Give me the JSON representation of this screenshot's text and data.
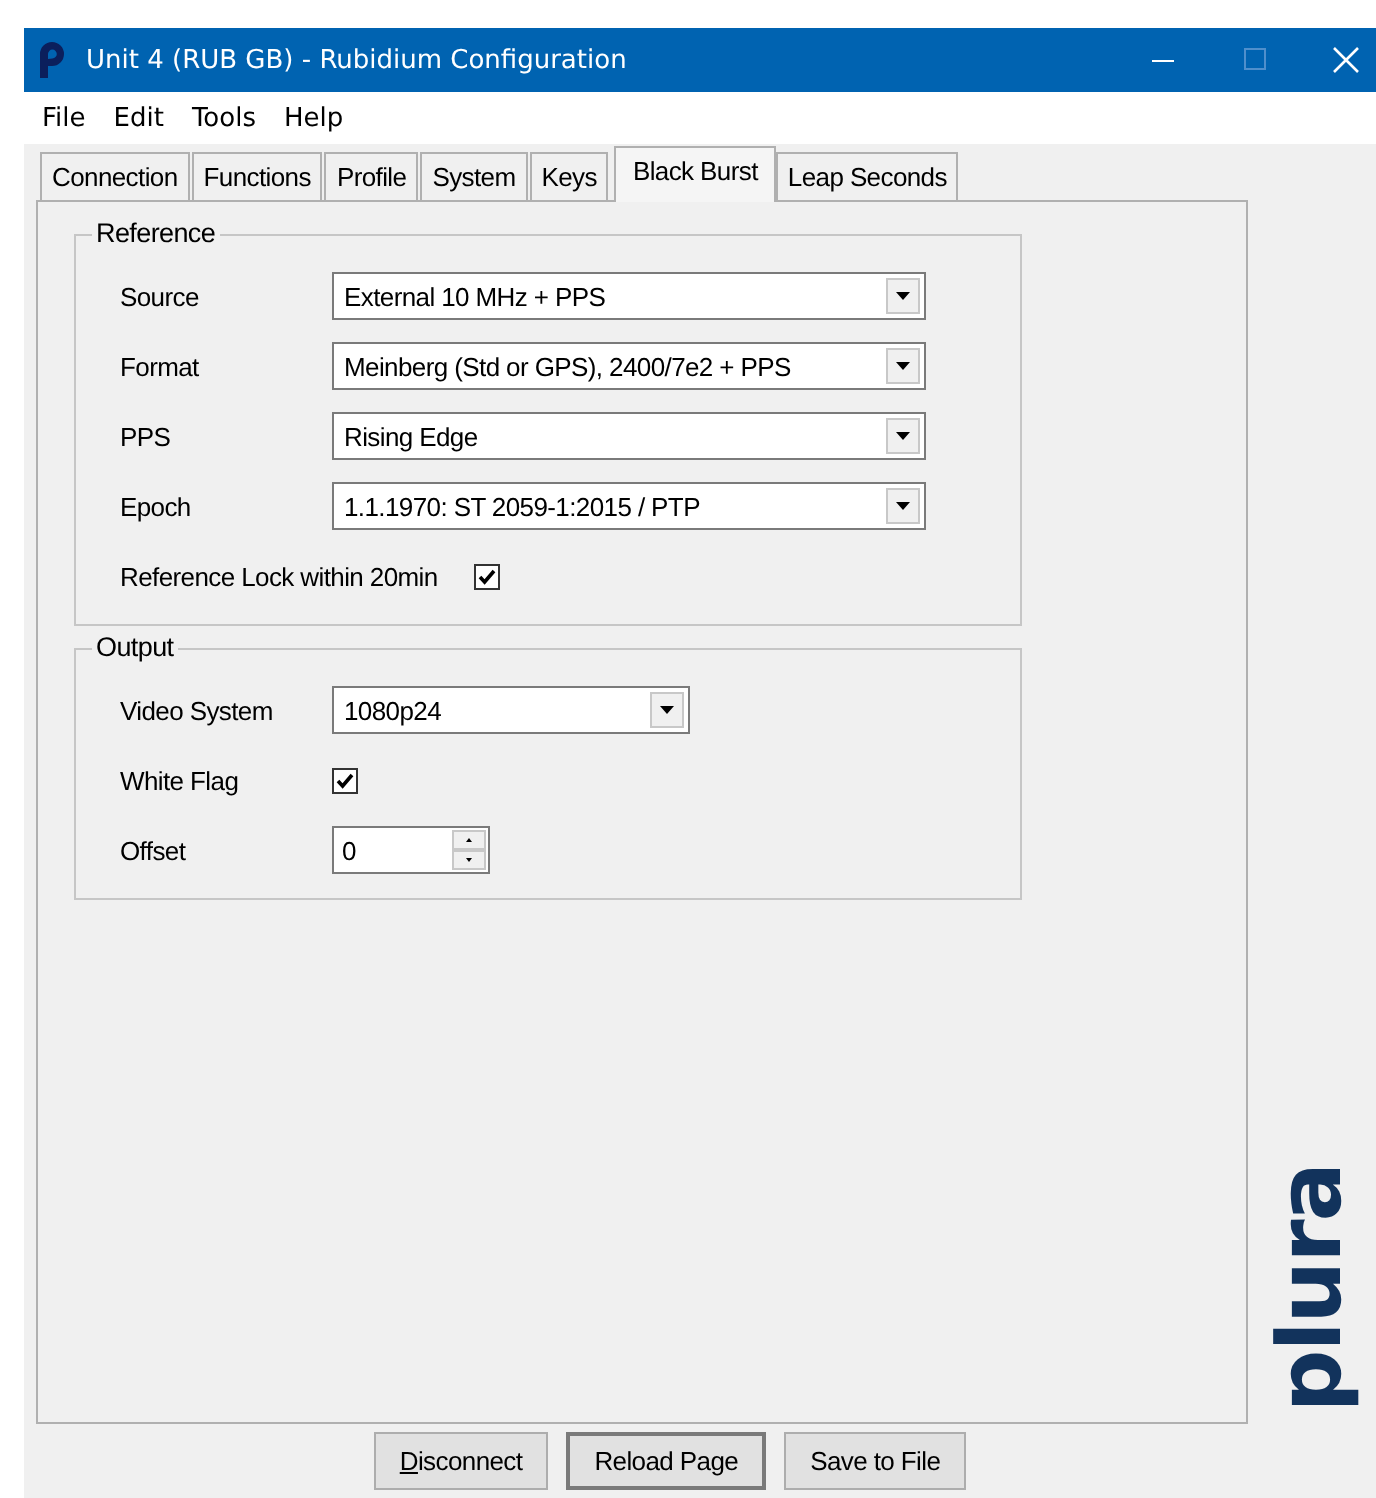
{
  "window": {
    "title": "Unit 4 (RUB GB) - Rubidium Configuration",
    "maximize_disabled": true
  },
  "menu": [
    "File",
    "Edit",
    "Tools",
    "Help"
  ],
  "tabs": [
    {
      "label": "Connection",
      "selected": false
    },
    {
      "label": "Functions",
      "selected": false
    },
    {
      "label": "Profile",
      "selected": false
    },
    {
      "label": "System",
      "selected": false
    },
    {
      "label": "Keys",
      "selected": false
    },
    {
      "label": "Black Burst",
      "selected": true
    },
    {
      "label": "Leap Seconds",
      "selected": false
    }
  ],
  "groups": [
    {
      "title": "Reference",
      "rows": [
        {
          "kind": "combo",
          "label": "Source",
          "value": "External 10 MHz + PPS"
        },
        {
          "kind": "combo",
          "label": "Format",
          "value": "Meinberg (Std or GPS), 2400/7e2 + PPS"
        },
        {
          "kind": "combo",
          "label": "PPS",
          "value": "Rising Edge"
        },
        {
          "kind": "combo",
          "label": "Epoch",
          "value": "1.1.1970: ST 2059-1:2015 / PTP"
        },
        {
          "kind": "check",
          "label": "Reference Lock within 20min",
          "checked": true
        }
      ]
    },
    {
      "title": "Output",
      "rows": [
        {
          "kind": "combo",
          "label": "Video System",
          "value": "1080p24"
        },
        {
          "kind": "check",
          "label": "White Flag",
          "checked": true
        },
        {
          "kind": "spin",
          "label": "Offset",
          "value": "0"
        }
      ]
    }
  ],
  "logo": "plura",
  "buttons": [
    {
      "label": "Disconnect",
      "mnemonic": true,
      "default": false
    },
    {
      "label": "Reload Page",
      "mnemonic": false,
      "default": true
    },
    {
      "label": "Save to File",
      "mnemonic": false,
      "default": false
    }
  ]
}
